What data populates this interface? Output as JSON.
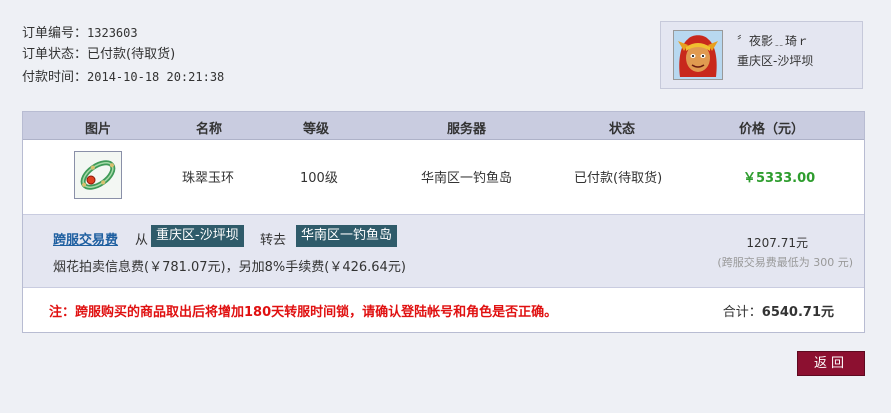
{
  "order": {
    "number_label": "订单编号：",
    "number": "1323603",
    "status_label": "订单状态：",
    "status": "已付款(待取货)",
    "paid_time_label": "付款时间：",
    "paid_time": "2014-10-18 20:21:38"
  },
  "seller": {
    "name": "〞夜影﹎琦ｒ",
    "server": "重庆区-沙坪坝",
    "avatar_icon": "warrior-avatar-icon"
  },
  "table": {
    "headers": [
      "图片",
      "名称",
      "等级",
      "服务器",
      "状态",
      "价格（元）"
    ],
    "item": {
      "thumb_icon": "jade-bracelet-icon",
      "name": "珠翠玉环",
      "level": "100级",
      "server": "华南区一钓鱼岛",
      "status": "已付款(待取货)",
      "price": "￥5333.00"
    }
  },
  "fee": {
    "link_label": "跨服交易费",
    "from_label": "从",
    "from_server": "重庆区-沙坪坝",
    "to_label": "转去",
    "to_server": "华南区一钓鱼岛",
    "detail": "烟花拍卖信息费(￥781.07元)，另加8%手续费(￥426.64元)",
    "amount": "1207.71元",
    "minimum_note": "(跨服交易费最低为 300 元)"
  },
  "notice": {
    "text": "注：跨服购买的商品取出后将增加180天转服时间锁，请确认登陆帐号和角色是否正确。",
    "total_label": "合计：",
    "total_value": "6540.71元"
  },
  "actions": {
    "back_label": "返回"
  },
  "colors": {
    "page_bg": "#eef0f5",
    "header_bg": "#c9cce0",
    "price_green": "#2e9d2e",
    "notice_red": "#e01010",
    "chip_bg": "#2f5b6a",
    "button_bg": "#8c1030"
  }
}
